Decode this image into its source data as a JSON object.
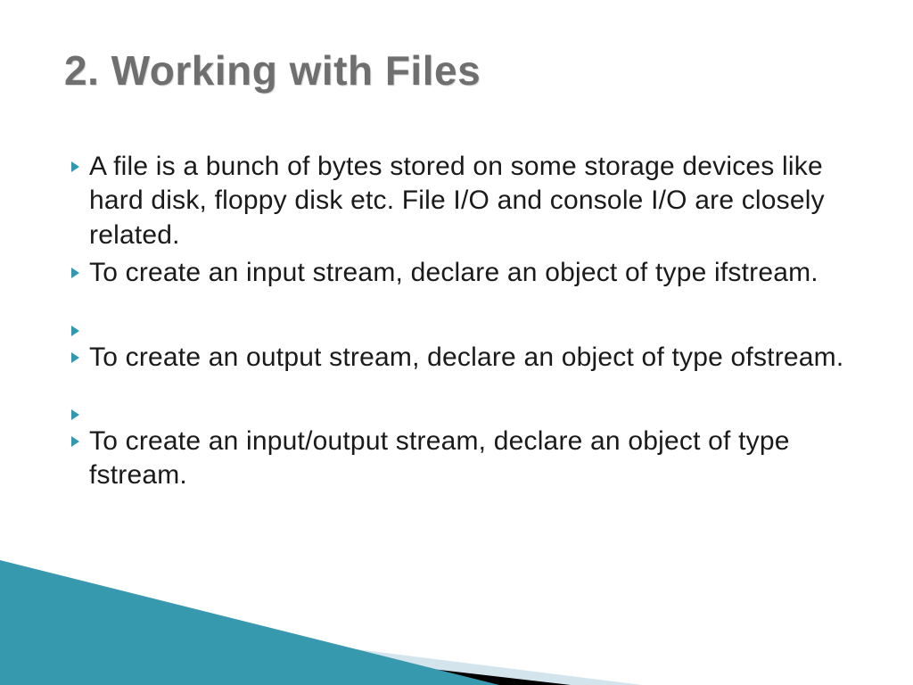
{
  "title": "2. Working with Files",
  "bullets": [
    {
      "text": "A file is a bunch of bytes stored on some storage devices like hard disk, floppy disk etc. File I/O and console I/O are closely related."
    },
    {
      "text": "To create an input stream, declare an object of type ifstream."
    },
    {
      "text": ""
    },
    {
      "text": "To create an output stream, declare an object of type ofstream."
    },
    {
      "text": ""
    },
    {
      "text": "To create an input/output stream, declare an object of type fstream."
    }
  ],
  "colors": {
    "bullet": "#2e9ab2",
    "title": "#6f6f6f",
    "tealTriangle": "#3799ae",
    "lightTriangle": "#d3e4ec"
  }
}
